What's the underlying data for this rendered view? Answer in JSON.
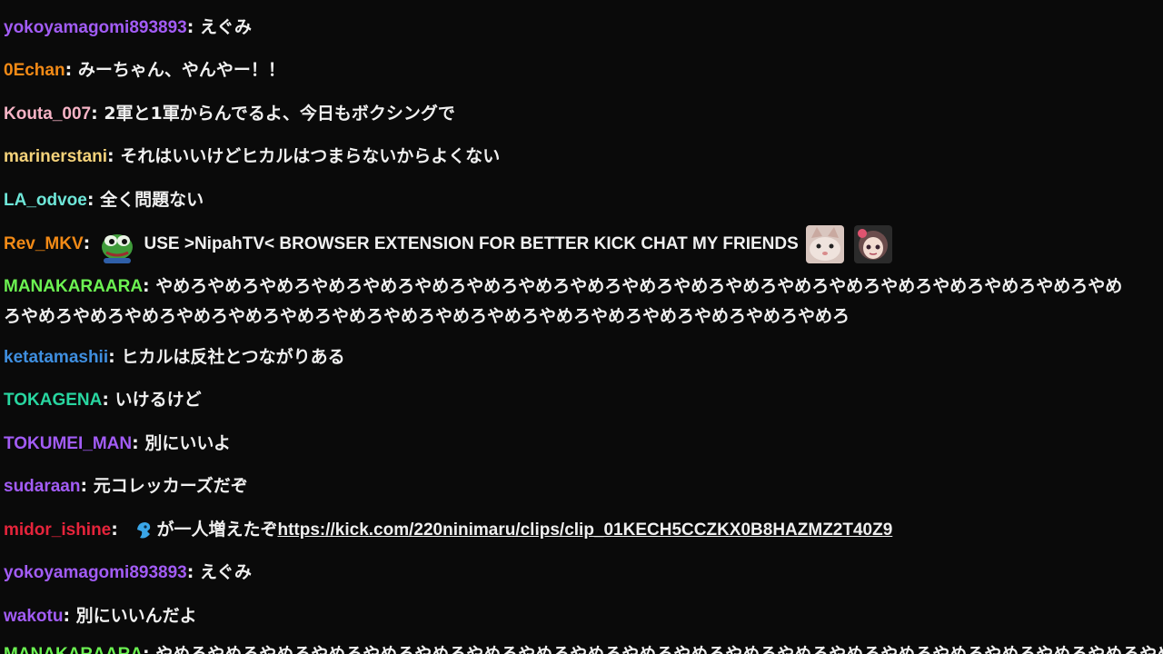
{
  "messages": [
    {
      "user": "yokoyamagomi893893",
      "color": "#a25cf5",
      "text": "えぐみ"
    },
    {
      "user": "0Echan",
      "color": "#f28a16",
      "text": "みーちゃん、やんやー！！"
    },
    {
      "user": "Kouta_007",
      "color": "#f7b4c6",
      "text": "2軍と1軍からんでるよ、今日もボクシングで"
    },
    {
      "user": "marinerstani",
      "color": "#f4d27a",
      "text": "それはいいけどヒカルはつまらないからよくない"
    },
    {
      "user": "LA_odvoe",
      "color": "#6ee6d8",
      "text": "全く問題ない"
    },
    {
      "user": "Rev_MKV",
      "color": "#f28a16",
      "emote_before": "pepe-emote",
      "text": "USE >NipahTV< BROWSER EXTENSION FOR BETTER KICK CHAT MY FRIENDS",
      "emotes_after": [
        "cat-emote",
        "anime-girl-emote"
      ]
    },
    {
      "user": "MANAKARAARA",
      "color": "#6cf252",
      "text": "やめろやめろやめろやめろやめろやめろやめろやめろやめろやめろやめろやめろやめろやめろやめろやめろやめろやめろやめろやめろやめろやめろやめろやめろやめろやめろやめろやめろやめろやめろやめろやめろやめろやめろやめろ"
    },
    {
      "user": "ketatamashii",
      "color": "#3f8fe0",
      "text": "ヒカルは反社とつながりある"
    },
    {
      "user": "TOKAGENA",
      "color": "#28d6a0",
      "text": "いけるけど"
    },
    {
      "user": "TOKUMEI_MAN",
      "color": "#a25cf5",
      "text": "別にいいよ"
    },
    {
      "user": "sudaraan",
      "color": "#a25cf5",
      "text": "元コレッカーズだぞ"
    },
    {
      "user": "midor_ishine",
      "color": "#e5243b",
      "emote_before": "blue-emote",
      "text": "が一人増えたぞ",
      "link": "https://kick.com/220ninimaru/clips/clip_01KECH5CCZKX0B8HAZMZ2T40Z9"
    },
    {
      "user": "yokoyamagomi893893",
      "color": "#a25cf5",
      "text": "えぐみ"
    },
    {
      "user": "wakotu",
      "color": "#a25cf5",
      "text": "別にいいんだよ"
    },
    {
      "user": "MANAKARAARA",
      "color": "#6cf252",
      "text": "やめろやめろやめろやめろやめろやめろやめろやめろやめろやめろやめろやめろやめろやめろやめろやめろやめろやめろやめろやめろ"
    }
  ]
}
